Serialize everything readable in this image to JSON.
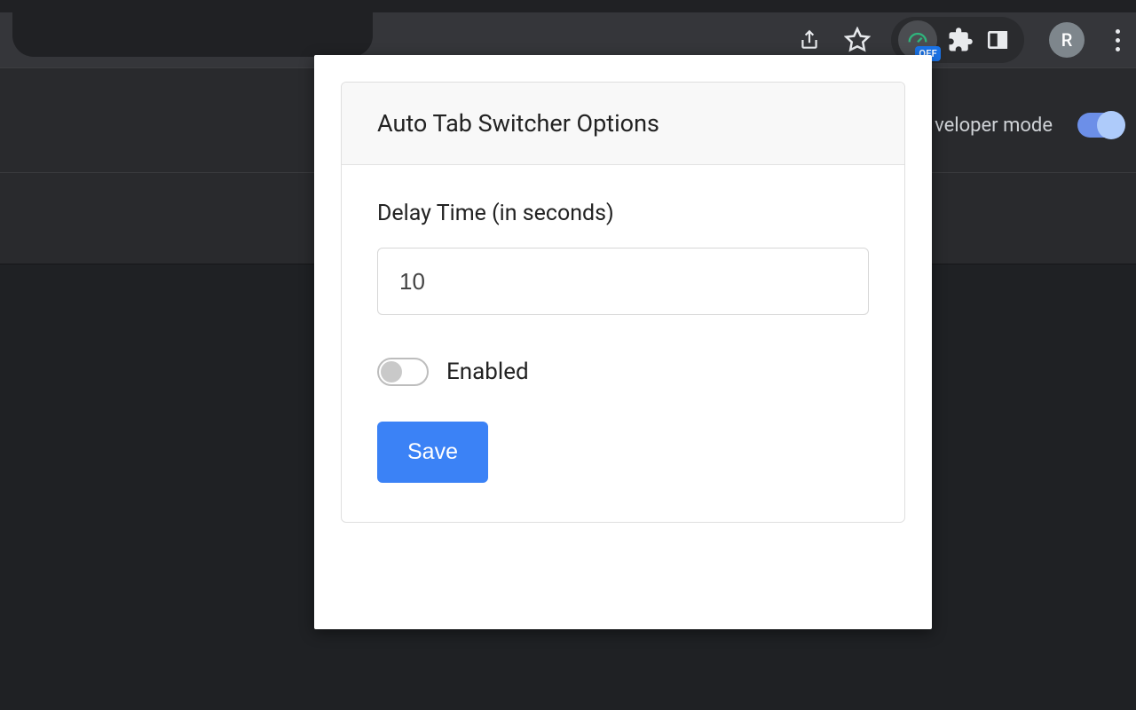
{
  "browser": {
    "extension_badge": "OFF",
    "profile_initial": "R",
    "developer_mode_label": "veloper mode"
  },
  "popup": {
    "title": "Auto Tab Switcher Options",
    "delay": {
      "label": "Delay Time (in seconds)",
      "value": "10"
    },
    "enabled": {
      "label": "Enabled",
      "state": false
    },
    "save_label": "Save"
  }
}
